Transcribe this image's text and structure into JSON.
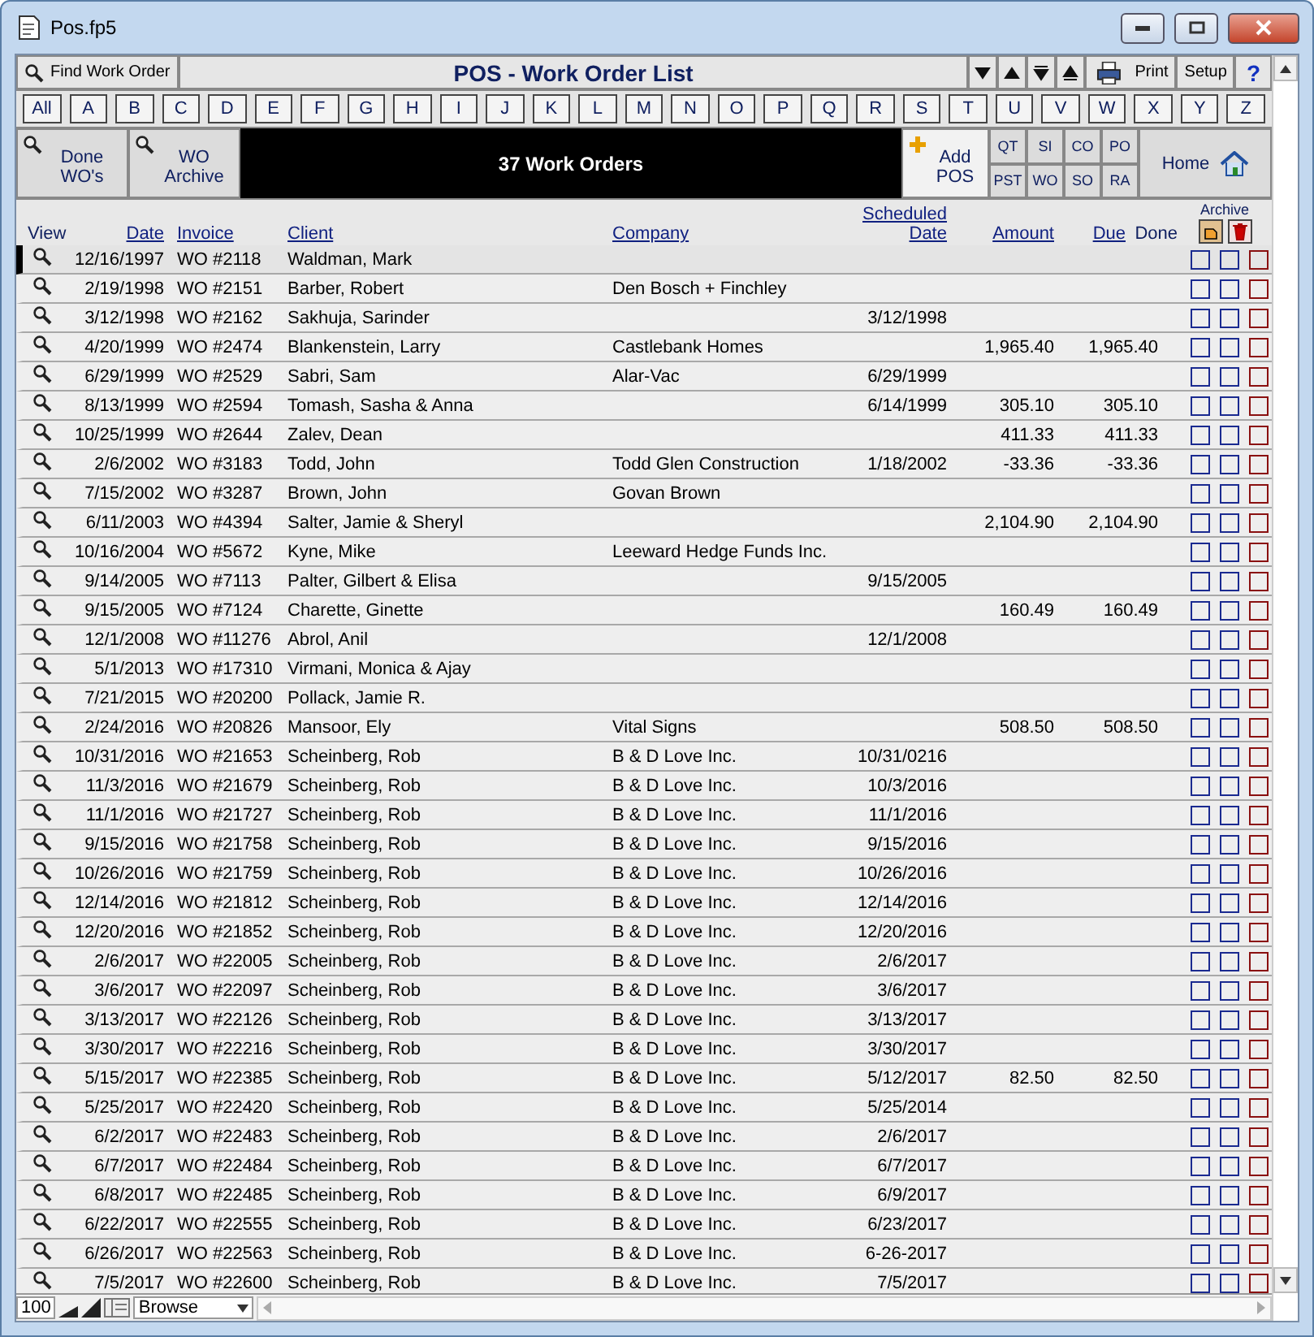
{
  "window": {
    "title": "Pos.fp5"
  },
  "toolbar": {
    "find_button": "Find Work Order",
    "title": "POS - Work Order List",
    "print_button": "Print",
    "setup_button": "Setup",
    "help_button": "?"
  },
  "alphabet": [
    {
      "label": "All"
    },
    {
      "label": "A"
    },
    {
      "label": "B"
    },
    {
      "label": "C"
    },
    {
      "label": "D"
    },
    {
      "label": "E"
    },
    {
      "label": "F"
    },
    {
      "label": "G"
    },
    {
      "label": "H"
    },
    {
      "label": "I"
    },
    {
      "label": "J"
    },
    {
      "label": "K"
    },
    {
      "label": "L"
    },
    {
      "label": "M"
    },
    {
      "label": "N"
    },
    {
      "label": "O"
    },
    {
      "label": "P"
    },
    {
      "label": "Q"
    },
    {
      "label": "R"
    },
    {
      "label": "S"
    },
    {
      "label": "T"
    },
    {
      "label": "U"
    },
    {
      "label": "V"
    },
    {
      "label": "W"
    },
    {
      "label": "X"
    },
    {
      "label": "Y"
    },
    {
      "label": "Z"
    }
  ],
  "band": {
    "search_buttons": [
      "Done WO's",
      "WO Archive"
    ],
    "count": "37 Work Orders",
    "add_button": "Add POS",
    "codes": [
      "QT",
      "SI",
      "CO",
      "PO",
      "PST",
      "WO",
      "SO",
      "RA"
    ],
    "home_button": "Home"
  },
  "table": {
    "columns": [
      "View",
      "Date",
      "Invoice",
      "Client",
      "Company",
      "Scheduled Date",
      "Amount",
      "Due",
      "Done"
    ],
    "archive_label": "Archive",
    "rows": [
      {
        "date": "12/16/1997",
        "invoice": "WO #2118",
        "client": "Waldman, Mark",
        "selected": true,
        "done": false,
        "archived": false,
        "deleted": false
      },
      {
        "date": "2/19/1998",
        "invoice": "WO #2151",
        "client": "Barber, Robert",
        "company": "Den Bosch + Finchley",
        "selected": false,
        "done": false,
        "archived": false,
        "deleted": false
      },
      {
        "date": "3/12/1998",
        "invoice": "WO #2162",
        "client": "Sakhuja, Sarinder",
        "scheduled": "3/12/1998",
        "selected": false,
        "done": false,
        "archived": false,
        "deleted": false
      },
      {
        "date": "4/20/1999",
        "invoice": "WO #2474",
        "client": "Blankenstein, Larry",
        "company": "Castlebank Homes",
        "amount": "1,965.40",
        "due": "1,965.40",
        "selected": false,
        "done": false,
        "archived": false,
        "deleted": false
      },
      {
        "date": "6/29/1999",
        "invoice": "WO #2529",
        "client": "Sabri, Sam",
        "company": "Alar-Vac",
        "scheduled": "6/29/1999",
        "selected": false,
        "done": false,
        "archived": false,
        "deleted": false
      },
      {
        "date": "8/13/1999",
        "invoice": "WO #2594",
        "client": "Tomash, Sasha & Anna",
        "scheduled": "6/14/1999",
        "amount": "305.10",
        "due": "305.10",
        "selected": false,
        "done": false,
        "archived": false,
        "deleted": false
      },
      {
        "date": "10/25/1999",
        "invoice": "WO #2644",
        "client": "Zalev, Dean",
        "amount": "411.33",
        "due": "411.33",
        "selected": false,
        "done": false,
        "archived": false,
        "deleted": false
      },
      {
        "date": "2/6/2002",
        "invoice": "WO #3183",
        "client": "Todd, John",
        "company": "Todd Glen Construction",
        "scheduled": "1/18/2002",
        "amount": "-33.36",
        "due": "-33.36",
        "selected": false,
        "done": false,
        "archived": false,
        "deleted": false
      },
      {
        "date": "7/15/2002",
        "invoice": "WO #3287",
        "client": "Brown, John",
        "company": "Govan Brown",
        "selected": false,
        "done": false,
        "archived": false,
        "deleted": false
      },
      {
        "date": "6/11/2003",
        "invoice": "WO #4394",
        "client": "Salter, Jamie & Sheryl",
        "amount": "2,104.90",
        "due": "2,104.90",
        "selected": false,
        "done": false,
        "archived": false,
        "deleted": false
      },
      {
        "date": "10/16/2004",
        "invoice": "WO #5672",
        "client": "Kyne, Mike",
        "company": "Leeward Hedge Funds Inc.",
        "selected": false,
        "done": false,
        "archived": false,
        "deleted": false
      },
      {
        "date": "9/14/2005",
        "invoice": "WO #7113",
        "client": "Palter, Gilbert & Elisa",
        "scheduled": "9/15/2005",
        "selected": false,
        "done": false,
        "archived": false,
        "deleted": false
      },
      {
        "date": "9/15/2005",
        "invoice": "WO #7124",
        "client": "Charette, Ginette",
        "amount": "160.49",
        "due": "160.49",
        "selected": false,
        "done": false,
        "archived": false,
        "deleted": false
      },
      {
        "date": "12/1/2008",
        "invoice": "WO #11276",
        "client": "Abrol, Anil",
        "scheduled": "12/1/2008",
        "selected": false,
        "done": false,
        "archived": false,
        "deleted": false
      },
      {
        "date": "5/1/2013",
        "invoice": "WO #17310",
        "client": "Virmani, Monica & Ajay",
        "selected": false,
        "done": false,
        "archived": false,
        "deleted": false
      },
      {
        "date": "7/21/2015",
        "invoice": "WO #20200",
        "client": "Pollack, Jamie R.",
        "selected": false,
        "done": false,
        "archived": false,
        "deleted": false
      },
      {
        "date": "2/24/2016",
        "invoice": "WO #20826",
        "client": "Mansoor, Ely",
        "company": "Vital Signs",
        "amount": "508.50",
        "due": "508.50",
        "selected": false,
        "done": false,
        "archived": false,
        "deleted": false
      },
      {
        "date": "10/31/2016",
        "invoice": "WO #21653",
        "client": "Scheinberg, Rob",
        "company": "B & D Love Inc.",
        "scheduled": "10/31/0216",
        "selected": false,
        "done": false,
        "archived": false,
        "deleted": false
      },
      {
        "date": "11/3/2016",
        "invoice": "WO #21679",
        "client": "Scheinberg, Rob",
        "company": "B & D Love Inc.",
        "scheduled": "10/3/2016",
        "selected": false,
        "done": false,
        "archived": false,
        "deleted": false
      },
      {
        "date": "11/1/2016",
        "invoice": "WO #21727",
        "client": "Scheinberg, Rob",
        "company": "B & D Love Inc.",
        "scheduled": "11/1/2016",
        "selected": false,
        "done": false,
        "archived": false,
        "deleted": false
      },
      {
        "date": "9/15/2016",
        "invoice": "WO #21758",
        "client": "Scheinberg, Rob",
        "company": "B & D Love Inc.",
        "scheduled": "9/15/2016",
        "selected": false,
        "done": false,
        "archived": false,
        "deleted": false
      },
      {
        "date": "10/26/2016",
        "invoice": "WO #21759",
        "client": "Scheinberg, Rob",
        "company": "B & D Love Inc.",
        "scheduled": "10/26/2016",
        "selected": false,
        "done": false,
        "archived": false,
        "deleted": false
      },
      {
        "date": "12/14/2016",
        "invoice": "WO #21812",
        "client": "Scheinberg, Rob",
        "company": "B & D Love Inc.",
        "scheduled": "12/14/2016",
        "selected": false,
        "done": false,
        "archived": false,
        "deleted": false
      },
      {
        "date": "12/20/2016",
        "invoice": "WO #21852",
        "client": "Scheinberg, Rob",
        "company": "B & D Love Inc.",
        "scheduled": "12/20/2016",
        "selected": false,
        "done": false,
        "archived": false,
        "deleted": false
      },
      {
        "date": "2/6/2017",
        "invoice": "WO #22005",
        "client": "Scheinberg, Rob",
        "company": "B & D Love Inc.",
        "scheduled": "2/6/2017",
        "selected": false,
        "done": false,
        "archived": false,
        "deleted": false
      },
      {
        "date": "3/6/2017",
        "invoice": "WO #22097",
        "client": "Scheinberg, Rob",
        "company": "B & D Love Inc.",
        "scheduled": "3/6/2017",
        "selected": false,
        "done": false,
        "archived": false,
        "deleted": false
      },
      {
        "date": "3/13/2017",
        "invoice": "WO #22126",
        "client": "Scheinberg, Rob",
        "company": "B & D Love Inc.",
        "scheduled": "3/13/2017",
        "selected": false,
        "done": false,
        "archived": false,
        "deleted": false
      },
      {
        "date": "3/30/2017",
        "invoice": "WO #22216",
        "client": "Scheinberg, Rob",
        "company": "B & D Love Inc.",
        "scheduled": "3/30/2017",
        "selected": false,
        "done": false,
        "archived": false,
        "deleted": false
      },
      {
        "date": "5/15/2017",
        "invoice": "WO #22385",
        "client": "Scheinberg, Rob",
        "company": "B & D Love Inc.",
        "scheduled": "5/12/2017",
        "amount": "82.50",
        "due": "82.50",
        "selected": false,
        "done": false,
        "archived": false,
        "deleted": false
      },
      {
        "date": "5/25/2017",
        "invoice": "WO #22420",
        "client": "Scheinberg, Rob",
        "company": "B & D Love Inc.",
        "scheduled": "5/25/2014",
        "selected": false,
        "done": false,
        "archived": false,
        "deleted": false
      },
      {
        "date": "6/2/2017",
        "invoice": "WO #22483",
        "client": "Scheinberg, Rob",
        "company": "B & D Love Inc.",
        "scheduled": "2/6/2017",
        "selected": false,
        "done": false,
        "archived": false,
        "deleted": false
      },
      {
        "date": "6/7/2017",
        "invoice": "WO #22484",
        "client": "Scheinberg, Rob",
        "company": "B & D Love Inc.",
        "scheduled": "6/7/2017",
        "selected": false,
        "done": false,
        "archived": false,
        "deleted": false
      },
      {
        "date": "6/8/2017",
        "invoice": "WO #22485",
        "client": "Scheinberg, Rob",
        "company": "B & D Love Inc.",
        "scheduled": "6/9/2017",
        "selected": false,
        "done": false,
        "archived": false,
        "deleted": false
      },
      {
        "date": "6/22/2017",
        "invoice": "WO #22555",
        "client": "Scheinberg, Rob",
        "company": "B & D Love Inc.",
        "scheduled": "6/23/2017",
        "selected": false,
        "done": false,
        "archived": false,
        "deleted": false
      },
      {
        "date": "6/26/2017",
        "invoice": "WO #22563",
        "client": "Scheinberg, Rob",
        "company": "B & D Love Inc.",
        "scheduled": "6-26-2017",
        "selected": false,
        "done": false,
        "archived": false,
        "deleted": false
      },
      {
        "date": "7/5/2017",
        "invoice": "WO #22600",
        "client": "Scheinberg, Rob",
        "company": "B & D Love Inc.",
        "scheduled": "7/5/2017",
        "selected": false,
        "done": false,
        "archived": false,
        "deleted": false
      }
    ]
  },
  "status_bar": {
    "zoom": "100",
    "mode": "Browse"
  }
}
